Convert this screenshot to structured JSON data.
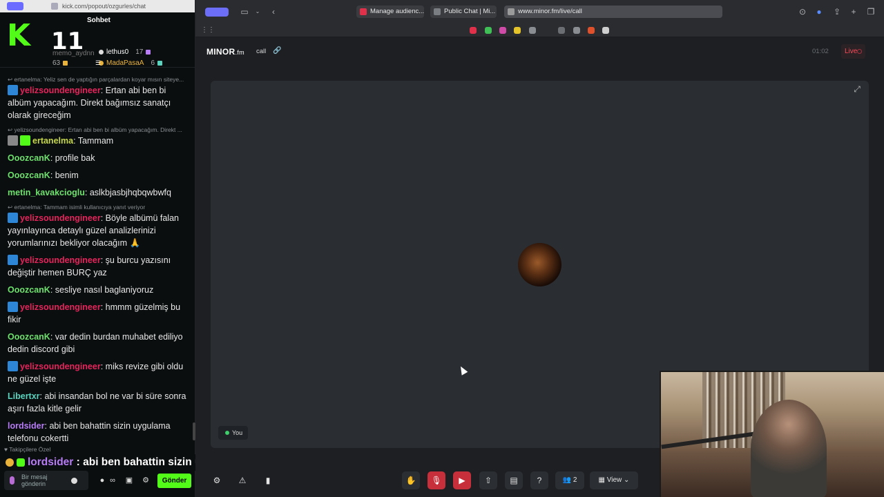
{
  "kick": {
    "url": "kick.com/popout/ozgurles/chat",
    "logo_letter": "K",
    "counter": "11",
    "title": "Sohbet",
    "top_users": [
      {
        "name": "memo_aydnn",
        "count": "63"
      },
      {
        "name": "lethus0",
        "count": "17"
      },
      {
        "name": "MadaPasaA",
        "count": "6"
      }
    ],
    "messages": [
      {
        "reply": "ertanelma: Yeliz sen de yaptığın parçalardan koyar mısın siteye...",
        "user": "yelizsoundengineer",
        "cls": "u-pink",
        "badge": "mod",
        "text": "Ertan abi ben bi albüm yapacağım. Direkt bağımsız sanatçı olarak gireceğim"
      },
      {
        "reply": "yelizsoundengineer: Ertan abi ben bi albüm yapacağım. Direkt ...",
        "user": "ertanelma",
        "cls": "u-olive",
        "badge": "av",
        "text": "Tammam"
      },
      {
        "reply": "",
        "user": "OoozcanK",
        "cls": "u-green",
        "badge": "",
        "text": "profile bak"
      },
      {
        "reply": "",
        "user": "OoozcanK",
        "cls": "u-green",
        "badge": "",
        "text": "benim"
      },
      {
        "reply": "",
        "user": "metin_kavakcioglu",
        "cls": "u-green",
        "badge": "",
        "text": "aslkbjasbjhqbqwbwfq"
      },
      {
        "reply": "ertanelma: Tammam isimli kullanıcıya yanıt veriyor",
        "user": "yelizsoundengineer",
        "cls": "u-pink",
        "badge": "mod",
        "text": "Böyle albümü falan yayınlayınca detaylı güzel analizlerinizi yorumlarınızı bekliyor olacağım 🙏"
      },
      {
        "reply": "",
        "user": "yelizsoundengineer",
        "cls": "u-pink",
        "badge": "mod",
        "text": "şu burcu yazısını değiştir hemen BURÇ yaz"
      },
      {
        "reply": "",
        "user": "OoozcanK",
        "cls": "u-green",
        "badge": "",
        "text": "sesliye nasıl baglaniyoruz"
      },
      {
        "reply": "",
        "user": "yelizsoundengineer",
        "cls": "u-pink",
        "badge": "mod",
        "text": "hmmm güzelmiş bu fikir"
      },
      {
        "reply": "",
        "user": "OoozcanK",
        "cls": "u-green",
        "badge": "",
        "text": "var dedin burdan muhabet ediliyo dedin discord gibi"
      },
      {
        "reply": "",
        "user": "yelizsoundengineer",
        "cls": "u-pink",
        "badge": "mod",
        "text": "miks revize gibi oldu ne güzel işte"
      },
      {
        "reply": "",
        "user": "Libertxr",
        "cls": "u-teal",
        "badge": "",
        "text": "abi insandan bol ne var bi süre sonra aşırı fazla kitle gelir"
      },
      {
        "reply": "",
        "user": "lordsider",
        "cls": "u-purple",
        "badge": "",
        "text": "abi ben bahattin sizin uygulama telefonu cokertti"
      }
    ],
    "sub_label": "Takipçilere Özel",
    "input_placeholder": "Bir mesaj gönderin",
    "send_label": "Gönder"
  },
  "caption": {
    "user": "lordsider",
    "text": "abi ben bahattin sizin uygulama telefonu cokertti"
  },
  "browser": {
    "tabs": [
      {
        "label": "Manage audienc...",
        "color": "#e0304a"
      },
      {
        "label": "Public Chat | Mi...",
        "color": "#7a7d82"
      },
      {
        "label": "www.minor.fm/live/call",
        "color": "#9a9a9a"
      }
    ],
    "favorites_colors": [
      "#e0304a",
      "#3fbf55",
      "#d04aa8",
      "#e5c32a",
      "#8a8d92",
      "#8a8d92",
      "#e0502a",
      "#8a8d92"
    ]
  },
  "app": {
    "brand": "MINOR",
    "brand_suffix": ".fm",
    "room": "call",
    "timer": "01:02",
    "live": "Live",
    "you": "You",
    "people_count": "2",
    "view_label": "View"
  }
}
